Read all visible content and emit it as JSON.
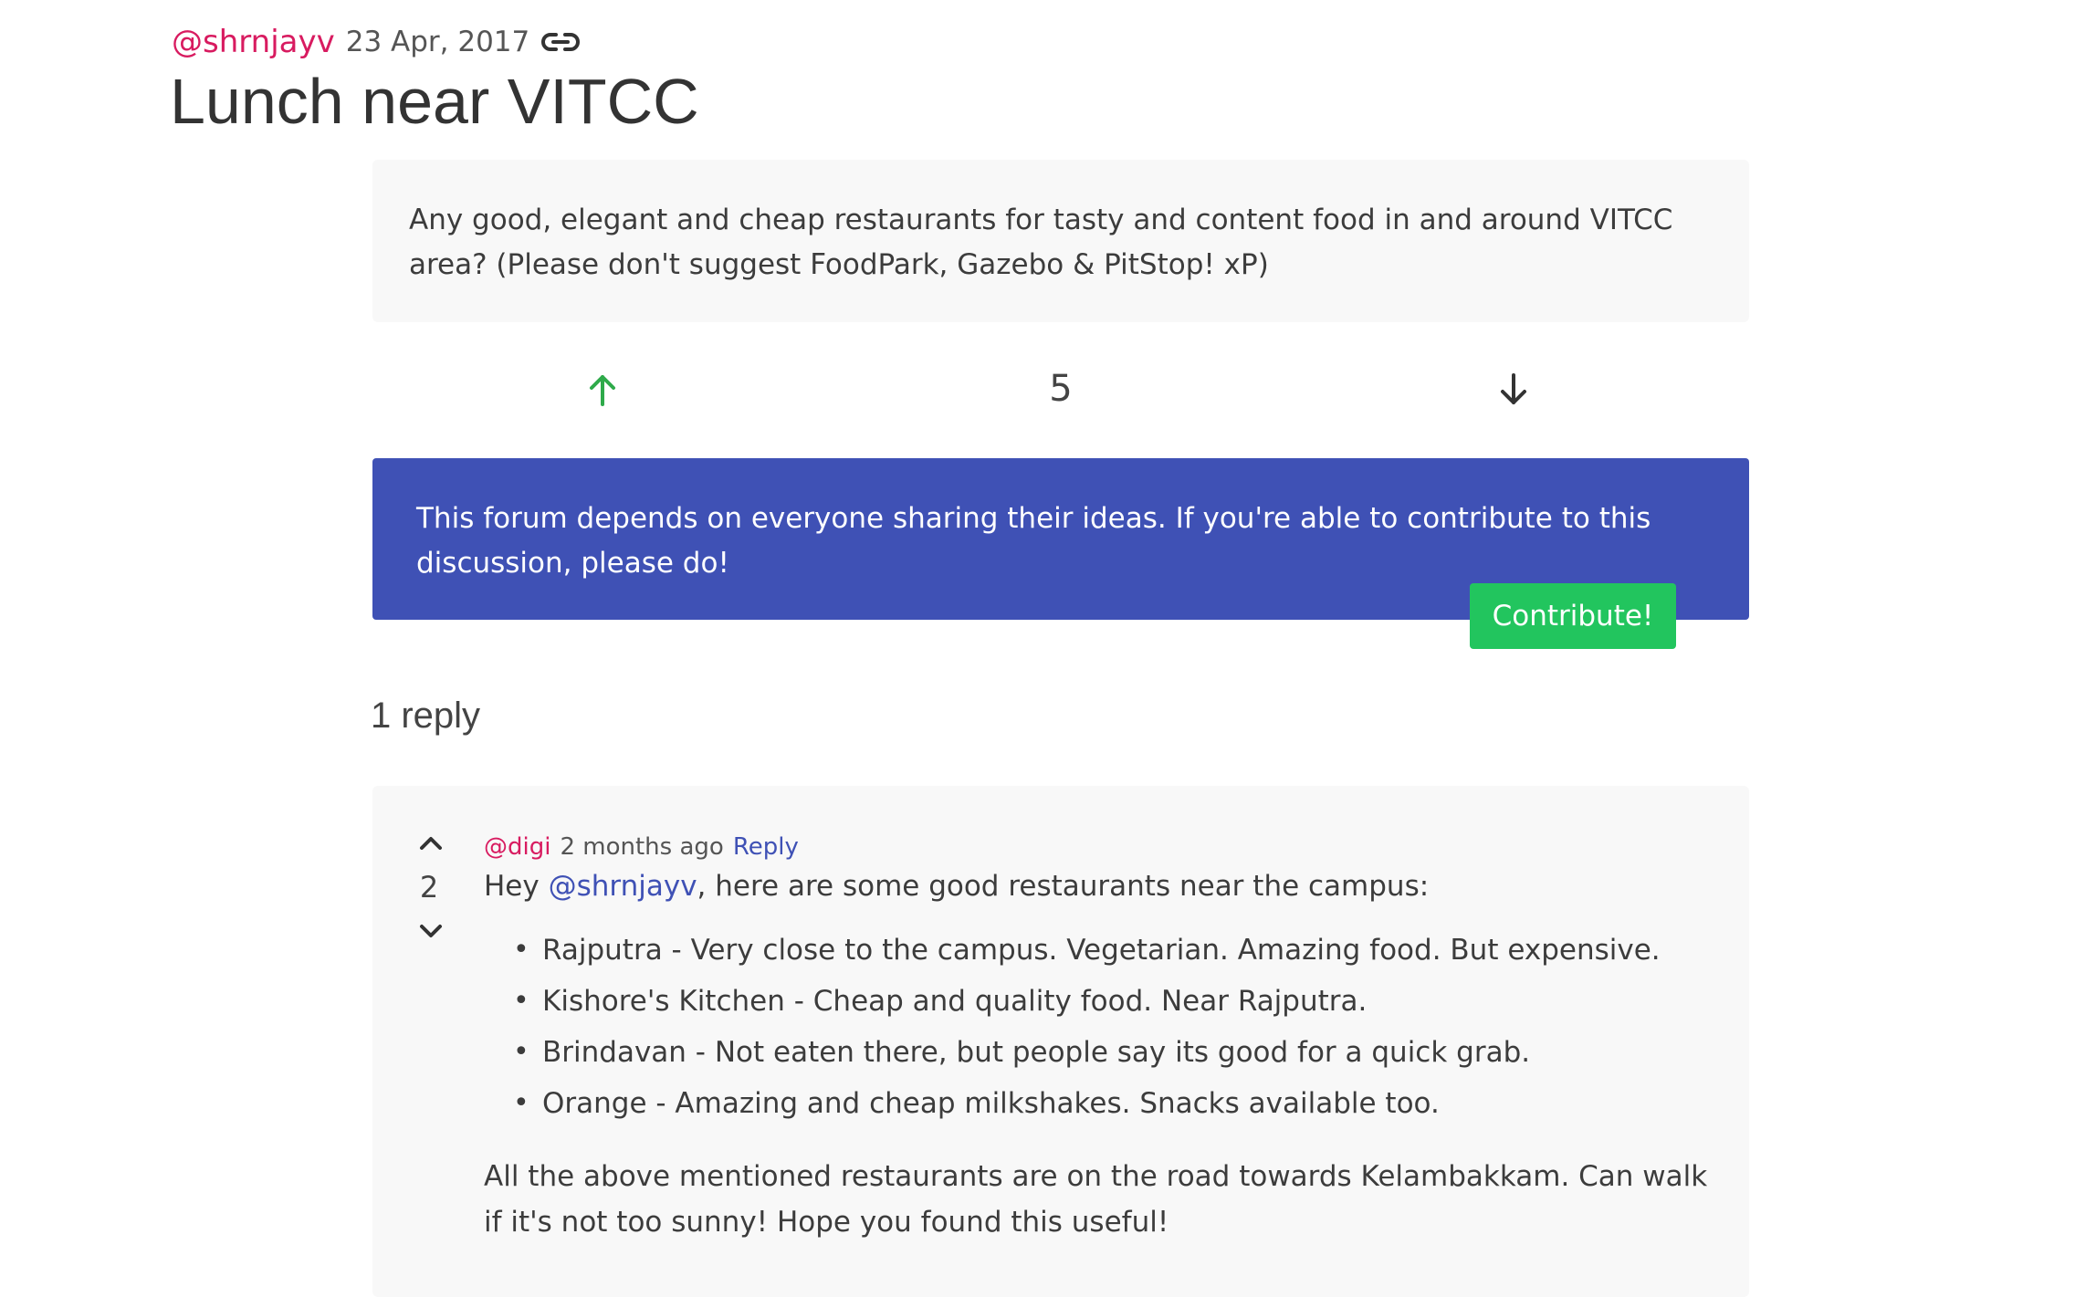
{
  "post": {
    "author": "@shrnjayv",
    "date": "23 Apr, 2017",
    "title": "Lunch near VITCC",
    "body": "Any good, elegant and cheap restaurants for tasty and content food in and around VITCC area? (Please don't suggest FoodPark, Gazebo & PitStop! xP)",
    "votes": "5",
    "icons": {
      "link": "link-icon",
      "upvote": "arrow-up-icon",
      "downvote": "arrow-down-icon"
    }
  },
  "contribute": {
    "message": "This forum depends on everyone sharing their ideas. If you're able to contribute to this discussion, please do!",
    "button_label": "Contribute!"
  },
  "replies_header": "1 reply",
  "reply": {
    "author": "@digi",
    "time": "2 months ago",
    "reply_label": "Reply",
    "votes": "2",
    "intro_before": "Hey ",
    "mention": "@shrnjayv",
    "intro_after": ", here are some good restaurants near the campus:",
    "items": [
      "Rajputra - Very close to the campus. Vegetarian. Amazing food. But expensive.",
      "Kishore's Kitchen - Cheap and quality food. Near Rajputra.",
      "Brindavan - Not eaten there, but people say its good for a quick grab.",
      "Orange - Amazing and cheap milkshakes. Snacks available too."
    ],
    "footer": "All the above mentioned restaurants are on the road towards Kelambakkam. Can walk if it's not too sunny! Hope you found this useful!",
    "icons": {
      "upvote": "chevron-up-icon",
      "downvote": "chevron-down-icon"
    }
  },
  "colors": {
    "author": "#d81b60",
    "accent_blue": "#3f51b5",
    "contribute_green": "#22c55e",
    "upvote_green": "#2eaa4a",
    "card_bg": "#f8f8f8"
  }
}
